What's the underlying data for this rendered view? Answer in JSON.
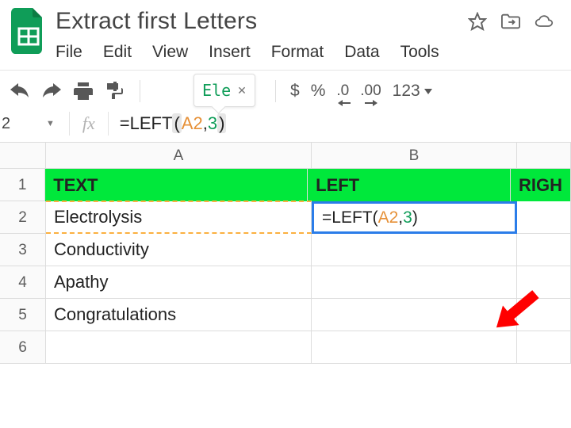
{
  "doc": {
    "title": "Extract first Letters"
  },
  "menus": [
    "File",
    "Edit",
    "View",
    "Insert",
    "Format",
    "Data",
    "Tools"
  ],
  "toolbar": {
    "tooltip_text": "Ele",
    "currency": "$",
    "percent": "%",
    "dec_dec": ".0",
    "inc_dec": ".00",
    "num_format": "123",
    "namebox": "2",
    "fx": "fx"
  },
  "formula": {
    "eq": "=",
    "fn": "LEFT",
    "lb": "(",
    "a1": "A2",
    "comma": ",",
    "a2": "3",
    "rb": ")"
  },
  "columns": {
    "a": "A",
    "b": "B",
    "c": ""
  },
  "headers": {
    "text": "TEXT",
    "left": "LEFT",
    "right": "RIGH"
  },
  "rows": {
    "1": "1",
    "2": "2",
    "3": "3",
    "4": "4",
    "5": "5",
    "6": "6"
  },
  "data": {
    "a2": "Electrolysis",
    "a3": "Conductivity",
    "a4": "Apathy",
    "a5": "Congratulations"
  },
  "cell_formula": {
    "eq": "=",
    "fn": "LEFT",
    "lb": "(",
    "a1": "A2",
    "comma": ",",
    "a2": "3",
    "rb": ")"
  }
}
